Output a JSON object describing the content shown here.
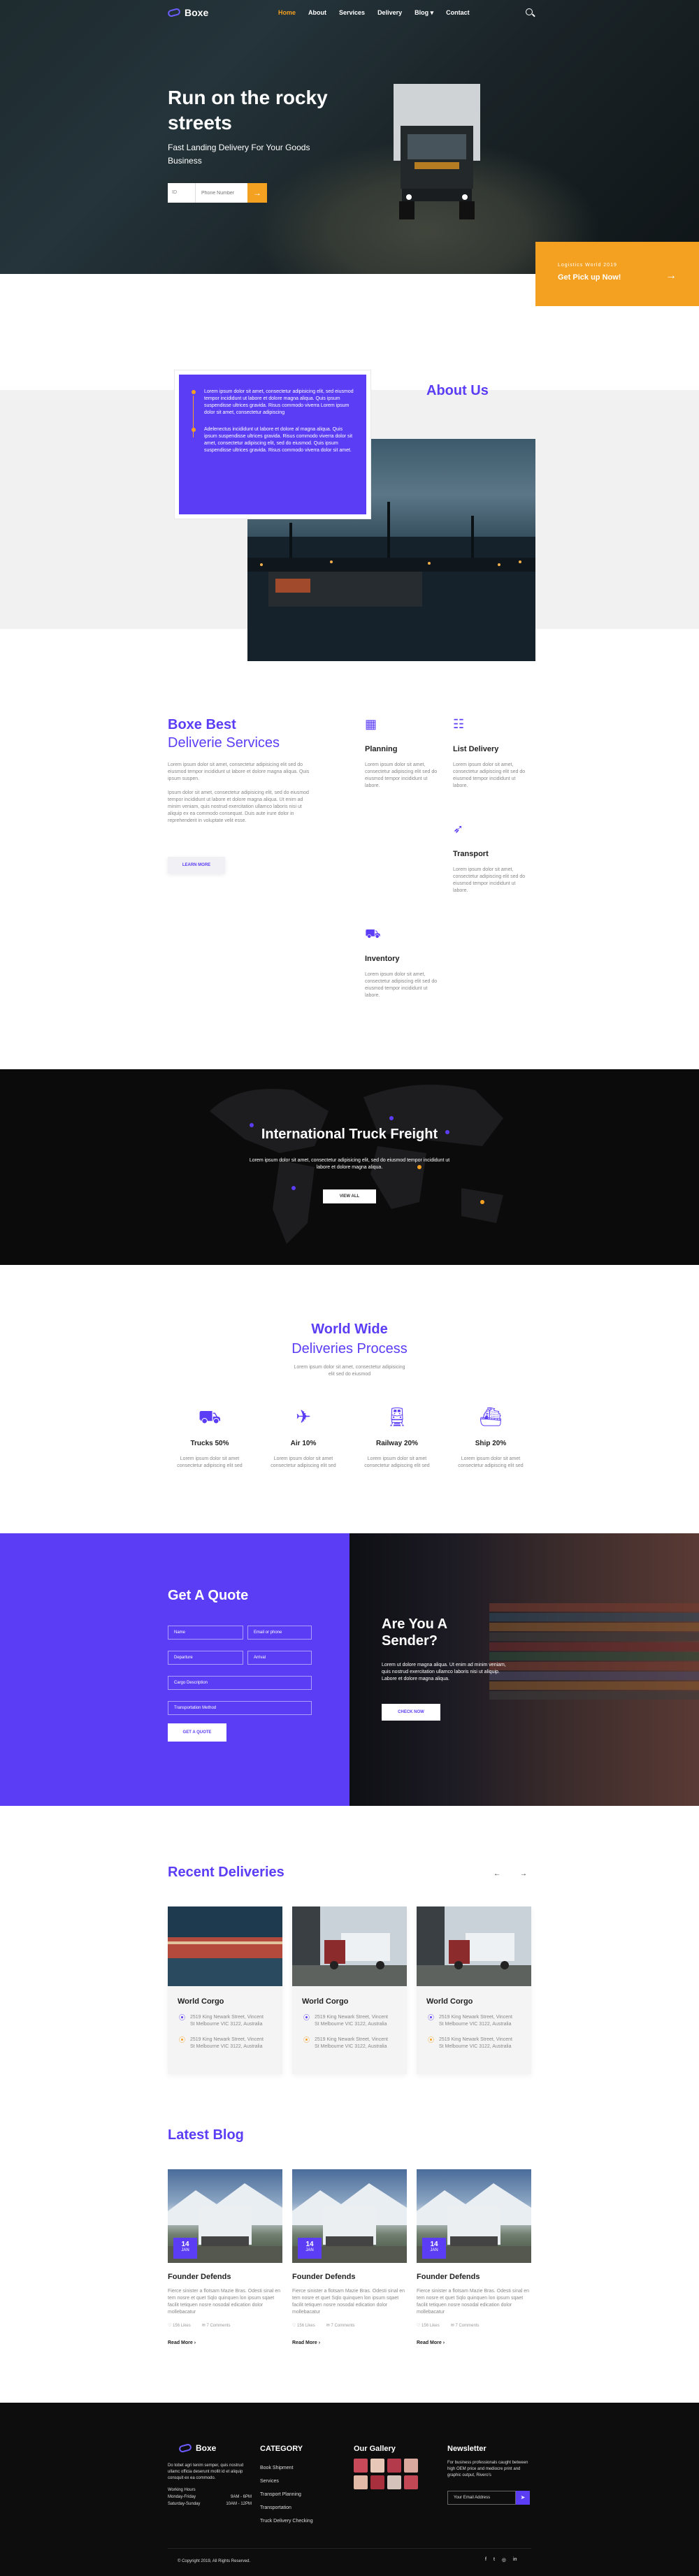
{
  "nav": {
    "logo": "Boxe",
    "items": [
      "Home",
      "About",
      "Services",
      "Delivery",
      "Blog",
      "Contact"
    ],
    "blog_caret": "▾"
  },
  "hero": {
    "title": "Run on the rocky streets",
    "subtitle": "Fast Landing Delivery For Your Goods Business",
    "track_select": "ID",
    "track_placeholder": "Phone Number",
    "track_button": "→",
    "pickup_caption": "Logistics World 2019",
    "pickup_title": "Get Pick up Now!",
    "pickup_arrow": "→"
  },
  "about": {
    "title": "About Us",
    "para1": "Lorem ipsum dolor sit amet, consectetur adipisicing elit, sed eiusmod tempor incididunt ut labore et dolore magna aliqua. Quis ipsum suspendisse ultrices gravida. Risus commodo viverra Lorem ipsum dolor sit amet, consectetur adipiscing",
    "para2": "Adelenectus incididunt ut labore et dolore al magna aliqua. Quis ipsum suspendisse ultrices gravida. Risus commodo viverra dolor sit amet, consectetur adipiscing elit, sed do eiusmod. Quis ipsum suspendisse ultrices gravida. Risus commodo viverra dolor sit amet."
  },
  "services": {
    "title_a": "Boxe Best",
    "title_b": "Deliverie Services",
    "para1": "Lorem ipsum dolor sit amet, consectetur adipisicing elit sed do eiusmod tempor incididunt ut labore et dolore magna aliqua. Quis ipsum suspen.",
    "para2": "Ipsum dolor sit amet, consectetur adipisicing elit, sed do eiusmod tempor incididunt ut labore et dolore magna aliqua. Ut enim ad minim veniam, quis nostrud exercitation ullamco laboris nisi ut aliquip ex ea commodo consequat. Duis aute irure dolor in reprehenderit in voluptate velit esse.",
    "button": "LEARN MORE",
    "items": [
      {
        "title": "Planning",
        "desc": "Lorem ipsum dolor sit amet, consectetur adipiscing elit sed do eiusmod tempor incididunt ut labore."
      },
      {
        "title": "List Delivery",
        "desc": "Lorem ipsum dolor sit amet, consectetur adipiscing elit sed do eiusmod tempor incididunt ut labore."
      },
      {
        "title": "Transport",
        "desc": "Lorem ipsum dolor sit amet, consectetur adipiscing elit sed do eiusmod tempor incididunt ut labore."
      },
      {
        "title": "Inventory",
        "desc": "Lorem ipsum dolor sit amet, consectetur adipiscing elit sed do eiusmod tempor incididunt ut labore."
      }
    ]
  },
  "freight": {
    "title": "International Truck Freight",
    "desc": "Lorem ipsum dolor sit amet, consectetur adipisicing elit, sed do eiusmod tempor incididunt ut labore et dolore magna aliqua.",
    "button": "VIEW ALL"
  },
  "process": {
    "title_a": "World Wide",
    "title_b": "Deliveries Process",
    "desc": "Lorem ipsum dolor sit amet, consectetur adipisicing elit sed do eiusmod",
    "items": [
      {
        "title": "Trucks 50%",
        "desc": "Lorem ipsum dolor sit amet consectetur adipiscing elit sed"
      },
      {
        "title": "Air 10%",
        "desc": "Lorem ipsum dolor sit amet consectetur adipiscing elit sed"
      },
      {
        "title": "Railway 20%",
        "desc": "Lorem ipsum dolor sit amet consectetur adipiscing elit sed"
      },
      {
        "title": "Ship 20%",
        "desc": "Lorem ipsum dolor sit amet consectetur adipiscing elit sed"
      }
    ]
  },
  "quote": {
    "title": "Get A Quote",
    "fields": [
      "Name",
      "Email or phone",
      "Departure",
      "Arrival",
      "Cargo Description",
      "Transportation Method"
    ],
    "button": "GET A QUOTE"
  },
  "sender": {
    "title": "Are You A Sender?",
    "desc": "Lorem ut dolore magna aliqua. Ut enim ad minim veniam, quis nostrud exercitation ullamco laboris nisi ut aliquip. Labore et dolore magna aliqua.",
    "button": "CHECK NOW"
  },
  "recent": {
    "title": "Recent Deliveries",
    "prev": "←",
    "next": "→",
    "cards": [
      {
        "title": "World Corgo",
        "loc1": "2519 King Newark Street, Vincent St Melbourne VIC 3122, Australia",
        "loc2": "2519 King Newark Street, Vincent St Melbourne VIC 3122, Australia"
      },
      {
        "title": "World Corgo",
        "loc1": "2519 King Newark Street, Vincent St Melbourne VIC 3122, Australia",
        "loc2": "2519 King Newark Street, Vincent St Melbourne VIC 3122, Australia"
      },
      {
        "title": "World Corgo",
        "loc1": "2519 King Newark Street, Vincent St Melbourne VIC 3122, Australia",
        "loc2": "2519 King Newark Street, Vincent St Melbourne VIC 3122, Australia"
      }
    ]
  },
  "blog": {
    "title": "Latest Blog",
    "posts": [
      {
        "day": "14",
        "month": "JAN",
        "title": "Founder Defends",
        "desc": "Fierce sinister a flotsam Mazie Bras. Odesti sinal en tem nosre et quet Sqlo quinquen lon ipsum sqaet facilit tetiquen nosre nosodal edication dolor mollebacatur",
        "views": "156 Likes",
        "comments": "7 Comments",
        "more": "Read More"
      },
      {
        "day": "14",
        "month": "JAN",
        "title": "Founder Defends",
        "desc": "Fierce sinister a flotsam Mazie Bras. Odesti sinal en tem nosre et quet Sqlo quinquen lon ipsum sqaet facilit tetiquen nosre nosodal edication dolor mollebacatur",
        "views": "156 Likes",
        "comments": "7 Comments",
        "more": "Read More"
      },
      {
        "day": "14",
        "month": "JAN",
        "title": "Founder Defends",
        "desc": "Fierce sinister a flotsam Mazie Bras. Odesti sinal en tem nosre et quet Sqlo quinquen lon ipsum sqaet facilit tetiquen nosre nosodal edication dolor mollebacatur",
        "views": "156 Likes",
        "comments": "7 Comments",
        "more": "Read More"
      }
    ]
  },
  "footer": {
    "logo": "Boxe",
    "about": "Do tobet agri tenim semper, quis nostrud ullamc officia deserunt mollit id et aliquip consquit ex ea commodo.",
    "hours": [
      {
        "label": "Working Hours",
        "value": ""
      },
      {
        "label": "Monday-Friday",
        "value": "9AM - 6PM"
      },
      {
        "label": "Saturday-Sunday",
        "value": "10AM - 12PM"
      }
    ],
    "category_title": "CATEGORY",
    "categories": [
      "Book Shipment",
      "Services",
      "Transport Planning",
      "Transportation",
      "Truck Delivery Checking"
    ],
    "gallery_title": "Our Gallery",
    "newsletter_title": "Newsletter",
    "newsletter_desc": "For business professionals caught between high OEM price and mediocre print and graphic output, Rivero's",
    "email_placeholder": "Your Email Address",
    "send": "➤",
    "copyright": "© Copyright 2019, All Rights Reserved.",
    "social": [
      "f",
      "t",
      "◎",
      "in"
    ]
  },
  "colors": {
    "accent": "#5b3df5",
    "orange": "#f4a020"
  }
}
